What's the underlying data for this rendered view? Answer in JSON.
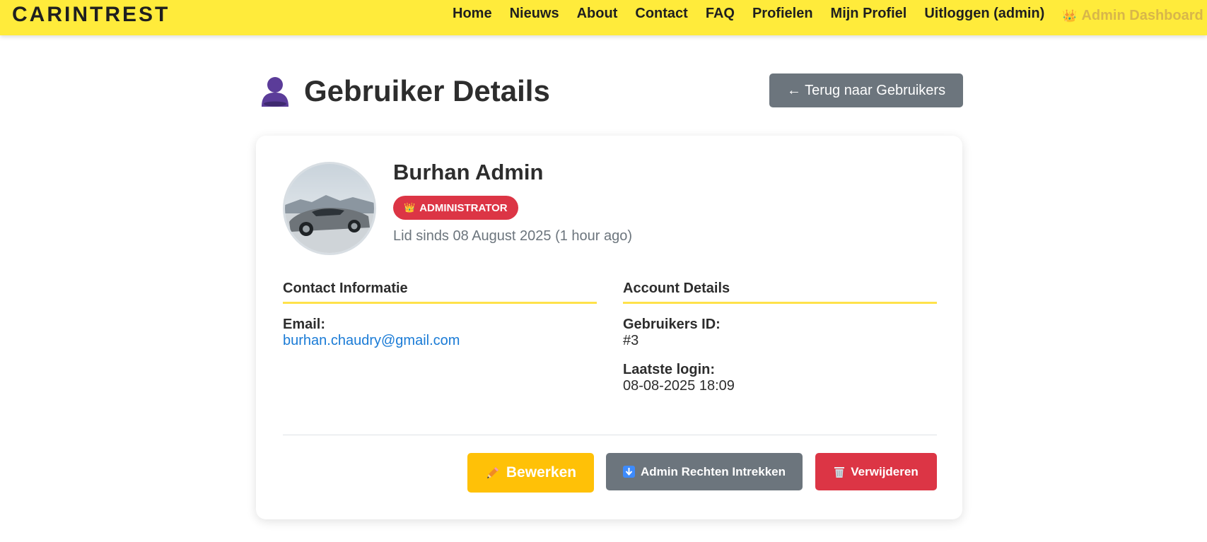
{
  "nav": {
    "brand": "CARINTREST",
    "links": [
      "Home",
      "Nieuws",
      "About",
      "Contact",
      "FAQ",
      "Profielen",
      "Mijn Profiel",
      "Uitloggen (admin)"
    ],
    "admin_link": "Admin Dashboard",
    "admin_icon": "crown-icon"
  },
  "page": {
    "title": "Gebruiker Details",
    "title_icon": "person-icon",
    "back_button": "← Terug naar Gebruikers"
  },
  "user": {
    "name": "Burhan Admin",
    "role": "ADMINISTRATOR",
    "member_since": "Lid sinds 08 August 2025 (1 hour ago)",
    "avatar": "avatar-car-photo"
  },
  "contact": {
    "title": "Contact Informatie",
    "email_label": "Email:",
    "email": "burhan.chaudry@gmail.com"
  },
  "account": {
    "title": "Account Details",
    "id_label": "Gebruikers ID:",
    "id_value": "#3",
    "login_label": "Laatste login:",
    "login_value": "08-08-2025 18:09"
  },
  "actions": {
    "edit": "Bewerken",
    "revoke": "Admin Rechten Intrekken",
    "delete": "Verwijderen"
  },
  "colors": {
    "navbar": "#ffeb3b",
    "primary_dark": "#6c757d",
    "danger": "#dc3545",
    "warning": "#ffc107",
    "link": "#1a7bd6",
    "accent_underline": "#ffe24a"
  }
}
